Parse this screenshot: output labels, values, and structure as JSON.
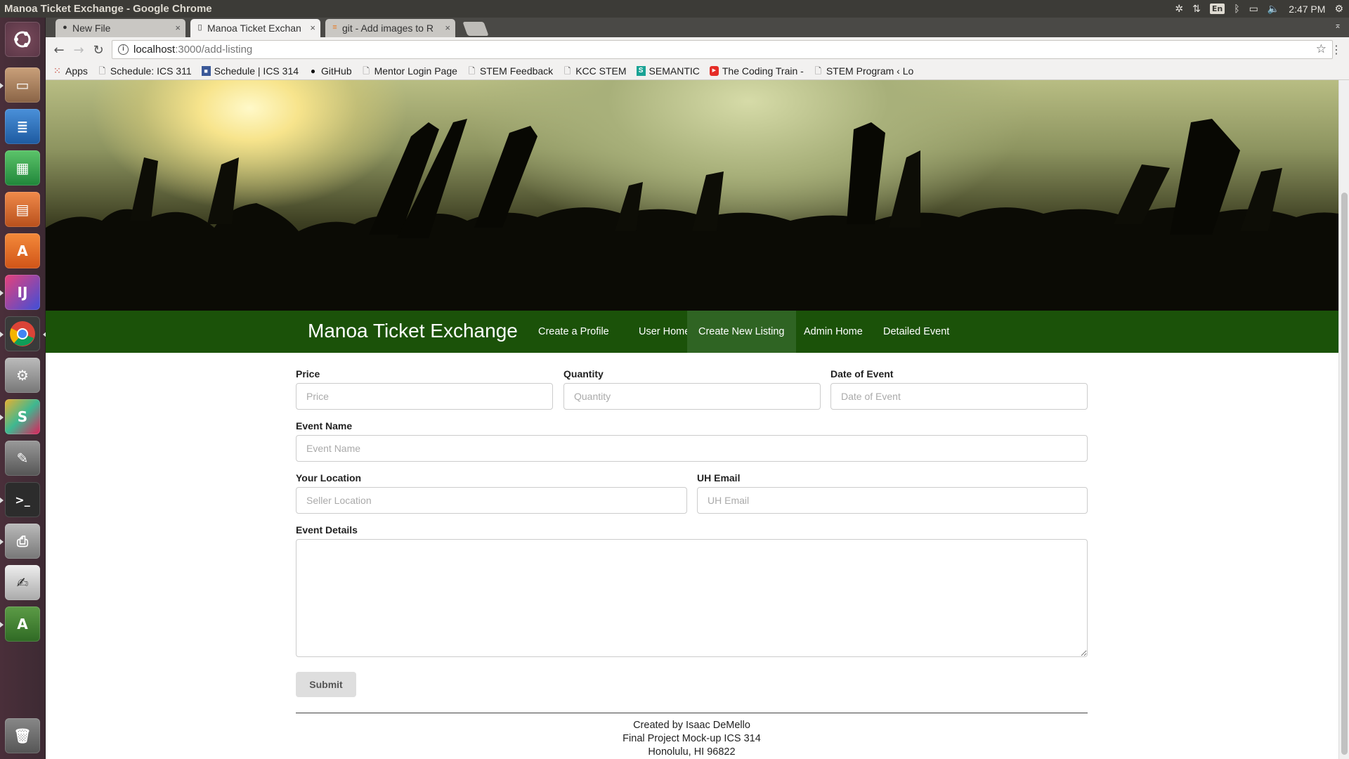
{
  "window": {
    "title": "Manoa Ticket Exchange - Google Chrome"
  },
  "system_tray": {
    "clock": "2:47 PM",
    "keyboard_layout": "En"
  },
  "launcher": {
    "apps": [
      {
        "name": "ubuntu-dash",
        "color": "#e05a2b"
      },
      {
        "name": "files",
        "color": "#b48a66"
      },
      {
        "name": "writer",
        "color": "#2a6db3"
      },
      {
        "name": "calc",
        "color": "#2e9c3d"
      },
      {
        "name": "impress",
        "color": "#cc6a2c"
      },
      {
        "name": "software-center",
        "color": "#e0672a"
      },
      {
        "name": "intellij",
        "color": "#2b2b6b"
      },
      {
        "name": "chrome",
        "color": "#3b3b3b"
      },
      {
        "name": "settings",
        "color": "#9a9a9a"
      },
      {
        "name": "slack",
        "color": "#e0aa2a"
      },
      {
        "name": "inkscape",
        "color": "#6a6a6a"
      },
      {
        "name": "terminal",
        "color": "#2c2c2c"
      },
      {
        "name": "printer",
        "color": "#8a8a8a"
      },
      {
        "name": "text-editor",
        "color": "#a9a9a9"
      },
      {
        "name": "updater",
        "color": "#3e6b32"
      },
      {
        "name": "trash",
        "color": "#6b6b6b"
      }
    ]
  },
  "tabs": [
    {
      "label": "New File",
      "icon": "github-icon"
    },
    {
      "label": "Manoa Ticket Exchan",
      "icon": "page-icon",
      "active": true
    },
    {
      "label": "git - Add images to R",
      "icon": "stackoverflow-icon"
    }
  ],
  "address_bar": {
    "host": "localhost",
    "path": ":3000/add-listing"
  },
  "bookmarks": [
    {
      "label": "Apps",
      "icon": "apps-icon"
    },
    {
      "label": "Schedule: ICS 311",
      "icon": "page-icon"
    },
    {
      "label": "Schedule | ICS 314",
      "icon": "blue-square-icon"
    },
    {
      "label": "GitHub",
      "icon": "github-icon"
    },
    {
      "label": "Mentor Login Page",
      "icon": "page-icon"
    },
    {
      "label": "STEM Feedback",
      "icon": "page-icon"
    },
    {
      "label": "KCC STEM",
      "icon": "page-icon"
    },
    {
      "label": "SEMANTIC",
      "icon": "semantic-icon"
    },
    {
      "label": "The Coding Train -",
      "icon": "youtube-icon"
    },
    {
      "label": "STEM Program ‹ Lo",
      "icon": "page-icon"
    }
  ],
  "navbar": {
    "brand": "Manoa Ticket Exchange",
    "links": [
      "Create a Profile",
      "User Home",
      "Create New Listing",
      "Admin Home",
      "Detailed Event"
    ],
    "active_link": "Create New Listing",
    "color": "#1b5209"
  },
  "form": {
    "price": {
      "label": "Price",
      "placeholder": "Price"
    },
    "quantity": {
      "label": "Quantity",
      "placeholder": "Quantity"
    },
    "date": {
      "label": "Date of Event",
      "placeholder": "Date of Event"
    },
    "event_name": {
      "label": "Event Name",
      "placeholder": "Event Name"
    },
    "location": {
      "label": "Your Location",
      "placeholder": "Seller Location"
    },
    "email": {
      "label": "UH Email",
      "placeholder": "UH Email"
    },
    "details": {
      "label": "Event Details"
    },
    "submit": "Submit"
  },
  "footer": {
    "lines": [
      "Created by Isaac DeMello",
      "Final Project Mock-up ICS 314",
      "Honolulu, HI 96822"
    ]
  }
}
